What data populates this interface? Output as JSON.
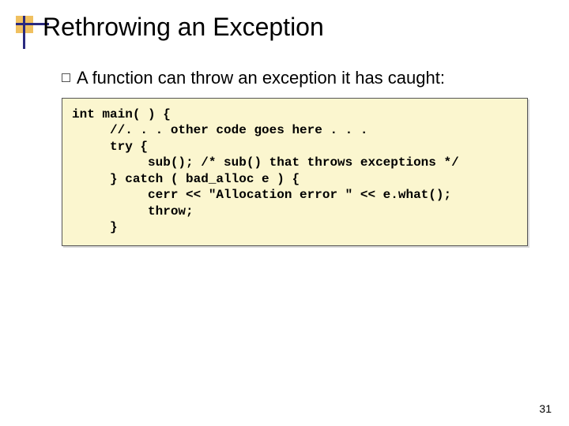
{
  "title": "Rethrowing an Exception",
  "bullet": "A function can throw an exception it has caught:",
  "code": "int main( ) {\n     //. . . other code goes here . . .\n     try {\n          sub(); /* sub() that throws exceptions */\n     } catch ( bad_alloc e ) {\n          cerr << \"Allocation error \" << e.what();\n          throw;\n     }",
  "page_number": "31"
}
